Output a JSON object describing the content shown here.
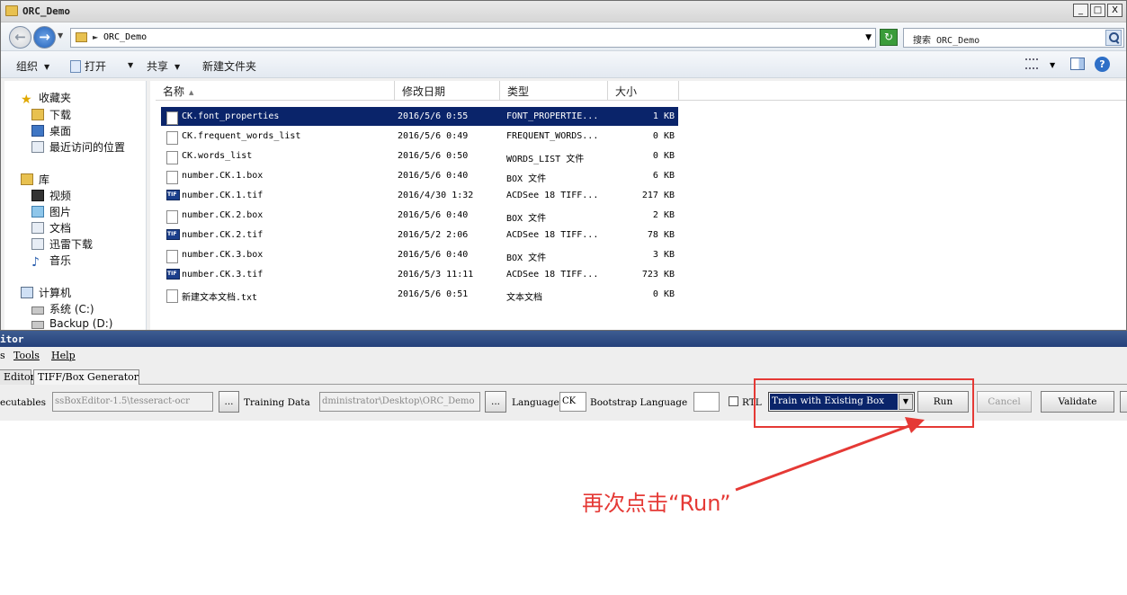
{
  "explorer": {
    "title": "ORC_Demo",
    "address": "ORC_Demo",
    "search_placeholder": "搜索 ORC_Demo",
    "window_buttons": [
      "_",
      "□",
      "X"
    ],
    "toolbar": {
      "organize": "组织",
      "open": "打开",
      "share": "共享",
      "new_folder": "新建文件夹"
    },
    "nav": {
      "favorites": "收藏夹",
      "downloads": "下载",
      "desktop": "桌面",
      "recent": "最近访问的位置",
      "libraries": "库",
      "videos": "视频",
      "pictures": "图片",
      "documents": "文档",
      "xunlei": "迅雷下载",
      "music": "音乐",
      "computer": "计算机",
      "drive_c": "系统 (C:)",
      "drive_d": "Backup (D:)"
    },
    "columns": {
      "name": "名称",
      "date": "修改日期",
      "type": "类型",
      "size": "大小"
    },
    "files": [
      {
        "name": "CK.font_properties",
        "date": "2016/5/6 0:55",
        "type": "FONT_PROPERTIE...",
        "size": "1 KB",
        "icon": "doc-icon",
        "selected": true
      },
      {
        "name": "CK.frequent_words_list",
        "date": "2016/5/6 0:49",
        "type": "FREQUENT_WORDS...",
        "size": "0 KB",
        "icon": "doc-icon"
      },
      {
        "name": "CK.words_list",
        "date": "2016/5/6 0:50",
        "type": "WORDS_LIST 文件",
        "size": "0 KB",
        "icon": "doc-icon"
      },
      {
        "name": "number.CK.1.box",
        "date": "2016/5/6 0:40",
        "type": "BOX 文件",
        "size": "6 KB",
        "icon": "doc-icon"
      },
      {
        "name": "number.CK.1.tif",
        "date": "2016/4/30 1:32",
        "type": "ACDSee 18 TIFF...",
        "size": "217 KB",
        "icon": "tif-icon"
      },
      {
        "name": "number.CK.2.box",
        "date": "2016/5/6 0:40",
        "type": "BOX 文件",
        "size": "2 KB",
        "icon": "doc-icon"
      },
      {
        "name": "number.CK.2.tif",
        "date": "2016/5/2 2:06",
        "type": "ACDSee 18 TIFF...",
        "size": "78 KB",
        "icon": "tif-icon"
      },
      {
        "name": "number.CK.3.box",
        "date": "2016/5/6 0:40",
        "type": "BOX 文件",
        "size": "3 KB",
        "icon": "doc-icon"
      },
      {
        "name": "number.CK.3.tif",
        "date": "2016/5/3 11:11",
        "type": "ACDSee 18 TIFF...",
        "size": "723 KB",
        "icon": "tif-icon"
      },
      {
        "name": "新建文本文档.txt",
        "date": "2016/5/6 0:51",
        "type": "文本文档",
        "size": "0 KB",
        "icon": "doc-icon"
      }
    ]
  },
  "editor": {
    "title": "itor",
    "menu": {
      "file_fragment": "s",
      "tools": "Tools",
      "help": "Help"
    },
    "tabs": {
      "box_editor": "Editor",
      "generator": "TIFF/Box Generator"
    },
    "controls": {
      "executables_label": "ecutables",
      "executables_value": "ssBoxEditor-1.5\\tesseract-ocr",
      "browse1": "...",
      "training_data_label": "Training Data",
      "training_data_value": "dministrator\\Desktop\\ORC_Demo",
      "browse2": "...",
      "language_label": "Language",
      "language_value": "CK",
      "bootstrap_label": "Bootstrap Language",
      "bootstrap_value": "",
      "rtl_label": "RTL",
      "mode_value": "Train with Existing Box",
      "run": "Run",
      "cancel": "Cancel",
      "validate": "Validate"
    }
  },
  "annotation": {
    "text": "再次点击“Run”",
    "color": "#e53935"
  }
}
